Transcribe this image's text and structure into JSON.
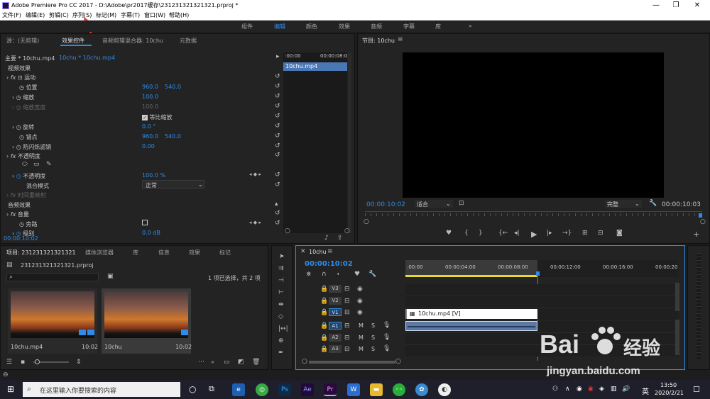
{
  "titlebar": {
    "title": "Adobe Premiere Pro CC 2017 - D:\\Adobe\\pr2017缓存\\231231321321321.prproj *",
    "min": "—",
    "max": "❐",
    "close": "✕"
  },
  "menu": [
    "文件(F)",
    "编辑(E)",
    "剪辑(C)",
    "序列(S)",
    "标记(M)",
    "字幕(T)",
    "窗口(W)",
    "帮助(H)"
  ],
  "workspaces": [
    "组件",
    "编辑",
    "颜色",
    "效果",
    "音频",
    "字幕",
    "库",
    "»"
  ],
  "effect_controls": {
    "tabs": [
      "源：(无剪辑)",
      "效果控件",
      "音频剪辑混合器: 10chu",
      "元数据"
    ],
    "clip_main": "主要 * 10chu.mp4",
    "clip_seq": "10chu * 10chu.mp4",
    "video_effects": "视频效果",
    "motion": "运动",
    "position_label": "位置",
    "position_x": "960.0",
    "position_y": "540.0",
    "scale_label": "缩放",
    "scale_val": "100.0",
    "scale_width_label": "缩放宽度",
    "scale_width_val": "100.0",
    "uniform_scale": "等比缩放",
    "rotation_label": "旋转",
    "rotation_val": "0.0 °",
    "anchor_label": "锚点",
    "anchor_x": "960.0",
    "anchor_y": "540.0",
    "antiflicker_label": "防闪烁滤镜",
    "antiflicker_val": "0.00",
    "opacity": "不透明度",
    "opacity_label": "不透明度",
    "opacity_val": "100.0 %",
    "blend_label": "混合模式",
    "blend_val": "正常",
    "time_remap": "时间重映射",
    "audio_effects": "音频效果",
    "volume": "音量",
    "bypass_label": "旁路",
    "level_label": "级别",
    "level_val": "0.0 dB",
    "timecode": "00:00:10:02",
    "mini_tc_start": ":00:00",
    "mini_tc_end": "00:00:08:0",
    "mini_clip": "10chu.mp4"
  },
  "program_monitor": {
    "title": "节目: 10chu",
    "timecode": "00:00:10:02",
    "fit": "适合",
    "quality": "完整",
    "duration": "00:00:10:03"
  },
  "project": {
    "tabs": [
      "项目: 231231321321321",
      "媒体浏览器",
      "库",
      "信息",
      "效果",
      "标记"
    ],
    "file": "231231321321321.prproj",
    "status": "1 项已选择，共 2 项",
    "items": [
      {
        "name": "10chu.mp4",
        "duration": "10:02"
      },
      {
        "name": "10chu",
        "duration": "10:02"
      }
    ]
  },
  "timeline": {
    "tab": "10chu",
    "timecode": "00:00:10:02",
    "ruler": [
      ":00:00",
      "00:00:04:00",
      "00:00:08:00",
      "00:00:12:00",
      "00:00:16:00",
      "00:00:20"
    ],
    "video_tracks": [
      "V3",
      "V2",
      "V1"
    ],
    "audio_tracks": [
      "A1",
      "A2",
      "A3"
    ],
    "clip_label": "10chu.mp4 [V]",
    "m": "M",
    "s": "S"
  },
  "watermark": {
    "brand": "Bai",
    "cn": "经验",
    "url": "jingyan.baidu.com"
  },
  "taskbar": {
    "search": "在这里输入你要搜索的内容",
    "time": "13:50",
    "date": "2020/2/21",
    "ime": "英",
    "apps": [
      "Ps",
      "Ae",
      "Pr",
      "W"
    ]
  }
}
